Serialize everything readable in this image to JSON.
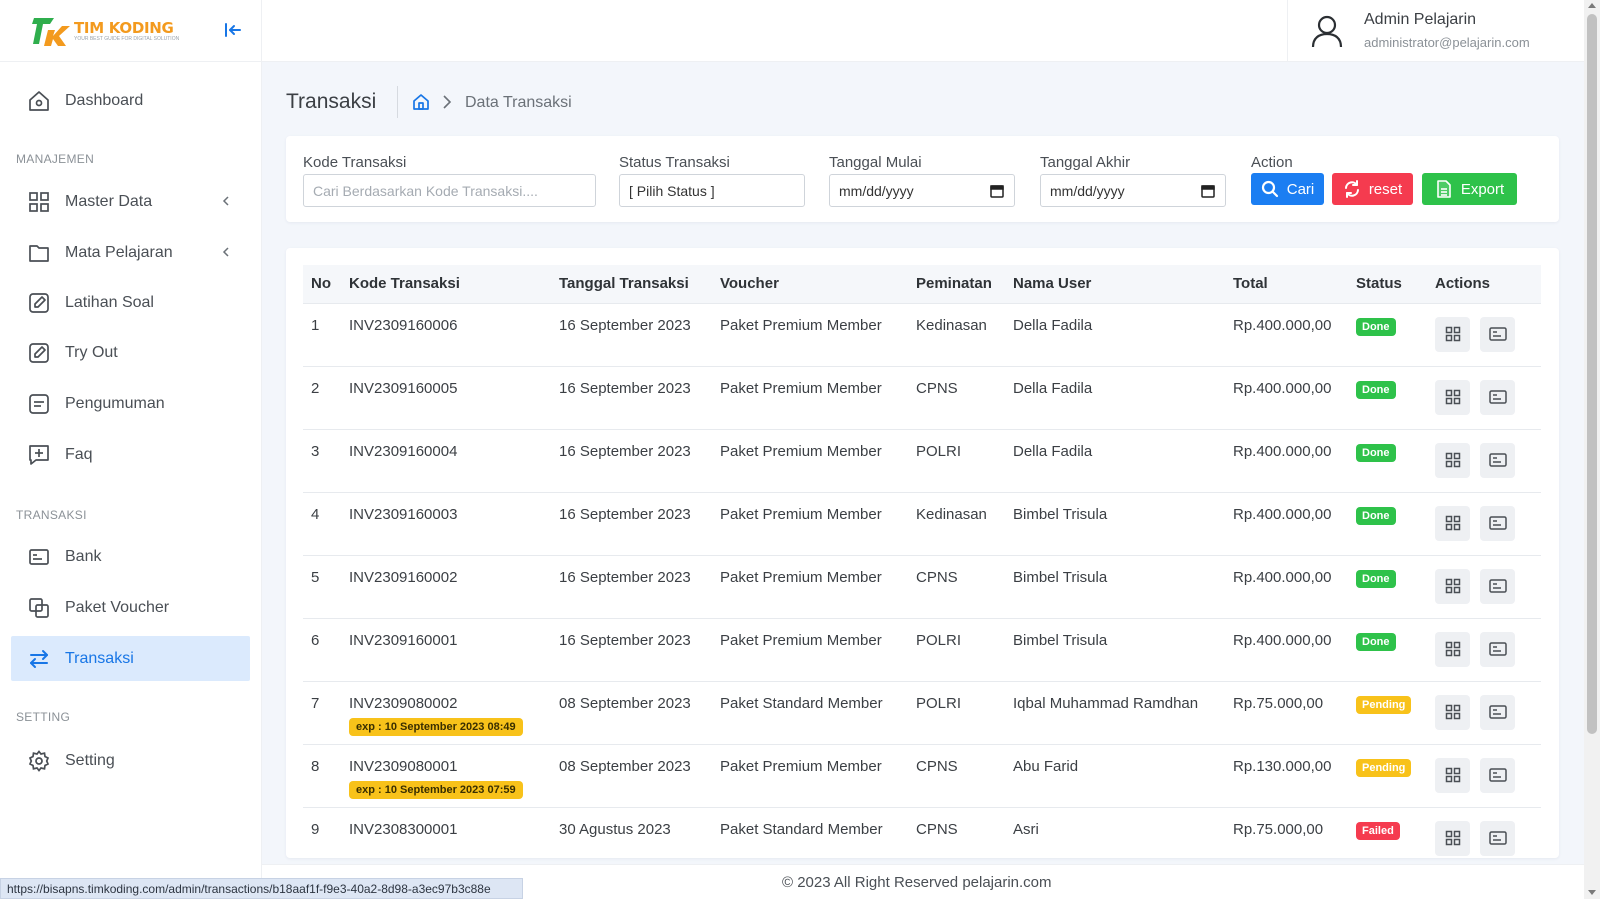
{
  "logo": {
    "title_a": "TIM ",
    "title_b": "KODING",
    "subtitle": "YOUR BEST GUIDE FOR DIGITAL SOLUTION"
  },
  "sidebar": {
    "dashboard": "Dashboard",
    "section_manajemen": "MANAJEMEN",
    "master_data": "Master Data",
    "mata_pelajaran": "Mata Pelajaran",
    "latihan_soal": "Latihan Soal",
    "try_out": "Try Out",
    "pengumuman": "Pengumuman",
    "faq": "Faq",
    "section_transaksi": "TRANSAKSI",
    "bank": "Bank",
    "paket_voucher": "Paket Voucher",
    "transaksi": "Transaksi",
    "section_setting": "SETTING",
    "setting": "Setting"
  },
  "user": {
    "name": "Admin Pelajarin",
    "email": "administrator@pelajarin.com"
  },
  "page": {
    "title": "Transaksi",
    "breadcrumb_current": "Data Transaksi"
  },
  "filters": {
    "kode_label": "Kode Transaksi",
    "kode_placeholder": "Cari Berdasarkan Kode Transaksi....",
    "status_label": "Status Transaksi",
    "status_value": "[ Pilih Status ]",
    "mulai_label": "Tanggal Mulai",
    "mulai_value": "mm/dd/yyyy",
    "akhir_label": "Tanggal Akhir",
    "akhir_value": "mm/dd/yyyy",
    "action_label": "Action",
    "cari": "Cari",
    "reset": "reset",
    "export": "Export"
  },
  "table": {
    "headers": [
      "No",
      "Kode Transaksi",
      "Tanggal Transaksi",
      "Voucher",
      "Peminatan",
      "Nama User",
      "Total",
      "Status",
      "Actions"
    ],
    "rows": [
      {
        "no": "1",
        "kode": "INV2309160006",
        "exp": "",
        "tanggal": "16 September 2023",
        "voucher": "Paket Premium Member",
        "peminatan": "Kedinasan",
        "user": "Della Fadila",
        "total": "Rp.400.000,00",
        "status": "Done",
        "status_color": "#2ec24a"
      },
      {
        "no": "2",
        "kode": "INV2309160005",
        "exp": "",
        "tanggal": "16 September 2023",
        "voucher": "Paket Premium Member",
        "peminatan": "CPNS",
        "user": "Della Fadila",
        "total": "Rp.400.000,00",
        "status": "Done",
        "status_color": "#2ec24a"
      },
      {
        "no": "3",
        "kode": "INV2309160004",
        "exp": "",
        "tanggal": "16 September 2023",
        "voucher": "Paket Premium Member",
        "peminatan": "POLRI",
        "user": "Della Fadila",
        "total": "Rp.400.000,00",
        "status": "Done",
        "status_color": "#2ec24a"
      },
      {
        "no": "4",
        "kode": "INV2309160003",
        "exp": "",
        "tanggal": "16 September 2023",
        "voucher": "Paket Premium Member",
        "peminatan": "Kedinasan",
        "user": "Bimbel Trisula",
        "total": "Rp.400.000,00",
        "status": "Done",
        "status_color": "#2ec24a"
      },
      {
        "no": "5",
        "kode": "INV2309160002",
        "exp": "",
        "tanggal": "16 September 2023",
        "voucher": "Paket Premium Member",
        "peminatan": "CPNS",
        "user": "Bimbel Trisula",
        "total": "Rp.400.000,00",
        "status": "Done",
        "status_color": "#2ec24a"
      },
      {
        "no": "6",
        "kode": "INV2309160001",
        "exp": "",
        "tanggal": "16 September 2023",
        "voucher": "Paket Premium Member",
        "peminatan": "POLRI",
        "user": "Bimbel Trisula",
        "total": "Rp.400.000,00",
        "status": "Done",
        "status_color": "#2ec24a"
      },
      {
        "no": "7",
        "kode": "INV2309080002",
        "exp": "exp : 10 September 2023 08:49",
        "tanggal": "08 September 2023",
        "voucher": "Paket Standard Member",
        "peminatan": "POLRI",
        "user": "Iqbal Muhammad Ramdhan",
        "total": "Rp.75.000,00",
        "status": "Pending",
        "status_color": "#f8c21a"
      },
      {
        "no": "8",
        "kode": "INV2309080001",
        "exp": "exp : 10 September 2023 07:59",
        "tanggal": "08 September 2023",
        "voucher": "Paket Premium Member",
        "peminatan": "CPNS",
        "user": "Abu Farid",
        "total": "Rp.130.000,00",
        "status": "Pending",
        "status_color": "#f8c21a"
      },
      {
        "no": "9",
        "kode": "INV2308300001",
        "exp": "",
        "tanggal": "30 Agustus 2023",
        "voucher": "Paket Standard Member",
        "peminatan": "CPNS",
        "user": "Asri",
        "total": "Rp.75.000,00",
        "status": "Failed",
        "status_color": "#f53b4f"
      }
    ]
  },
  "footer": {
    "text": "© 2023 All Right Reserved pelajarin.com"
  },
  "status_url": "https://bisapns.timkoding.com/admin/transactions/b18aaf1f-f9e3-40a2-8d98-a3ec97b3c88e"
}
